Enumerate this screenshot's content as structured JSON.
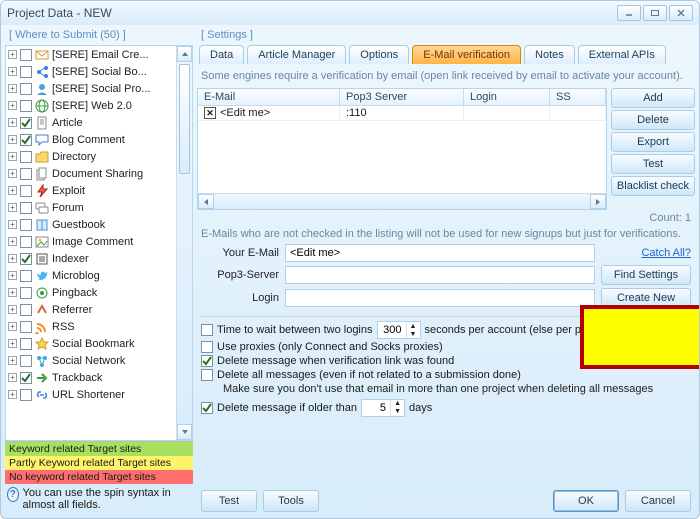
{
  "window": {
    "title": "Project Data - NEW"
  },
  "left_panel": {
    "header": "[ Where to Submit (50) ]",
    "items": [
      {
        "label": "[SERE] Email Cre...",
        "checked": false,
        "icon": "mail"
      },
      {
        "label": "[SERE] Social Bo...",
        "checked": false,
        "icon": "share"
      },
      {
        "label": "[SERE] Social Pro...",
        "checked": false,
        "icon": "user"
      },
      {
        "label": "[SERE] Web 2.0",
        "checked": false,
        "icon": "web"
      },
      {
        "label": "Article",
        "checked": true,
        "icon": "doc"
      },
      {
        "label": "Blog Comment",
        "checked": true,
        "icon": "comment"
      },
      {
        "label": "Directory",
        "checked": false,
        "icon": "folder"
      },
      {
        "label": "Document Sharing",
        "checked": false,
        "icon": "docs"
      },
      {
        "label": "Exploit",
        "checked": false,
        "icon": "bolt"
      },
      {
        "label": "Forum",
        "checked": false,
        "icon": "chat"
      },
      {
        "label": "Guestbook",
        "checked": false,
        "icon": "book"
      },
      {
        "label": "Image Comment",
        "checked": false,
        "icon": "img"
      },
      {
        "label": "Indexer",
        "checked": true,
        "icon": "index"
      },
      {
        "label": "Microblog",
        "checked": false,
        "icon": "twitter"
      },
      {
        "label": "Pingback",
        "checked": false,
        "icon": "ping"
      },
      {
        "label": "Referrer",
        "checked": false,
        "icon": "ref"
      },
      {
        "label": "RSS",
        "checked": false,
        "icon": "rss"
      },
      {
        "label": "Social Bookmark",
        "checked": false,
        "icon": "star"
      },
      {
        "label": "Social Network",
        "checked": false,
        "icon": "net"
      },
      {
        "label": "Trackback",
        "checked": true,
        "icon": "track"
      },
      {
        "label": "URL Shortener",
        "checked": false,
        "icon": "link"
      }
    ],
    "legend": [
      {
        "text": "Keyword related Target sites",
        "bg": "#a8e05f"
      },
      {
        "text": "Partly Keyword related Target sites",
        "bg": "#fff36b"
      },
      {
        "text": "No keyword related Target sites",
        "bg": "#ff6e6e"
      }
    ],
    "tip": "You can use the spin syntax in almost all fields."
  },
  "settings": {
    "header": "[ Settings ]",
    "tabs": [
      "Data",
      "Article Manager",
      "Options",
      "E-Mail verification",
      "Notes",
      "External APIs"
    ],
    "active_tab": 3,
    "note": "Some engines require a verification by email (open link received by email to activate your account).",
    "table": {
      "columns": [
        "E-Mail",
        "Pop3 Server",
        "Login",
        "SS"
      ],
      "rows": [
        {
          "checked": true,
          "email": "<Edit me>",
          "pop3": ":110",
          "login": "",
          "ss": ""
        }
      ]
    },
    "side_buttons": [
      "Add",
      "Delete",
      "Export",
      "Test",
      "Blacklist check"
    ],
    "count": "Count: 1",
    "hint": "E-Mails who are not checked in the listing will not be used for new signups but just for verifications.",
    "form": {
      "email_label": "Your E-Mail",
      "email_value": "<Edit me>",
      "pop3_label": "Pop3-Server",
      "pop3_value": "",
      "login_label": "Login",
      "login_value": "",
      "catch_all": "Catch All?",
      "find": "Find Settings",
      "create": "Create New"
    },
    "checks": {
      "c1": {
        "checked": false,
        "label": "Time to wait between two logins",
        "value": "300",
        "unit": "seconds per account (else per pop3 server)"
      },
      "c2": {
        "checked": false,
        "label": "Use proxies (only Connect and Socks proxies)"
      },
      "c3": {
        "checked": true,
        "label": "Delete message when verification link was found"
      },
      "c4": {
        "checked": false,
        "label": "Delete all messages (even if not related to a submission done)",
        "sub": "Make sure you don't use that email in more than one project when deleting all messages"
      },
      "c5": {
        "checked": true,
        "label": "Delete message if older than",
        "value": "5",
        "unit": "days"
      }
    },
    "buttons": {
      "test": "Test",
      "tools": "Tools",
      "ok": "OK",
      "cancel": "Cancel"
    }
  }
}
